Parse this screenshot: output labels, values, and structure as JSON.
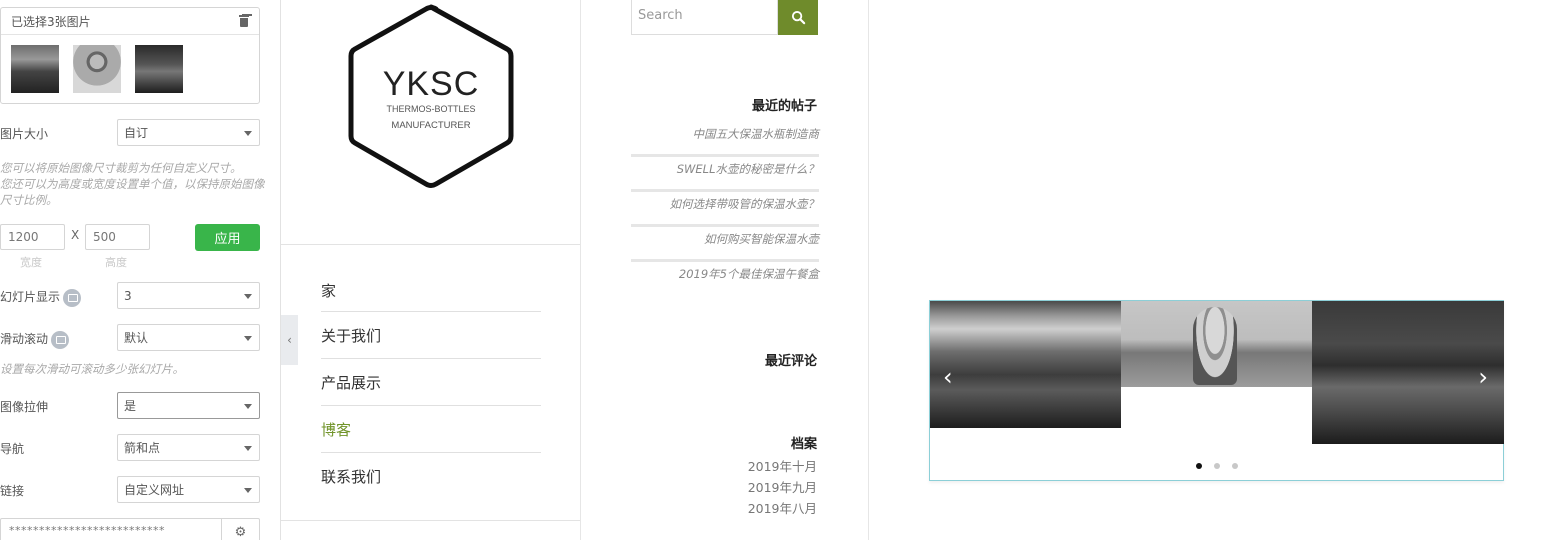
{
  "editor": {
    "gallery_title": "已选择3张图片",
    "image_size": {
      "label": "图片大小",
      "value": "自订"
    },
    "size_hint": [
      "您可以将原始图像尺寸裁剪为任何自定义尺寸。",
      "您还可以为高度或宽度设置单个值，以保持原始图像",
      "尺寸比例。"
    ],
    "width_value": "1200",
    "height_value": "500",
    "x_separator": "X",
    "apply_label": "应用",
    "width_label": "宽度",
    "height_label": "高度",
    "slides_to_show": {
      "label": "幻灯片显示",
      "value": "3"
    },
    "slides_to_scroll": {
      "label": "滑动滚动",
      "value": "默认"
    },
    "scroll_hint": "设置每次滑动可滚动多少张幻灯片。",
    "image_stretch": {
      "label": "图像拉伸",
      "value": "是"
    },
    "navigation": {
      "label": "导航",
      "value": "箭和点"
    },
    "link": {
      "label": "链接",
      "value": "自定义网址"
    },
    "link_url_value": "**************************"
  },
  "site": {
    "logo_main": "YKSC",
    "logo_sub1": "THERMOS-BOTTLES",
    "logo_sub2": "MANUFACTURER",
    "nav": [
      "家",
      "关于我们",
      "产品展示",
      "博客",
      "联系我们"
    ],
    "active_nav_index": 3,
    "accent_color": "#71942a"
  },
  "sidebar": {
    "search_placeholder": "Search",
    "recent_posts_title": "最近的帖子",
    "recent_posts": [
      "中国五大保温水瓶制造商",
      "SWELL水壶的秘密是什么？",
      "如何选择带吸管的保温水壶？",
      "如何购买智能保温水壶",
      "2019年5个最佳保温午餐盒"
    ],
    "recent_comments_title": "最近评论",
    "archives_title": "档案",
    "archives": [
      "2019年十月",
      "2019年九月",
      "2019年八月"
    ]
  },
  "slider": {
    "prev_icon": "‹",
    "next_icon": "›",
    "dot_count": 3,
    "active_dot": 0,
    "border_color": "#8ccfd7"
  }
}
